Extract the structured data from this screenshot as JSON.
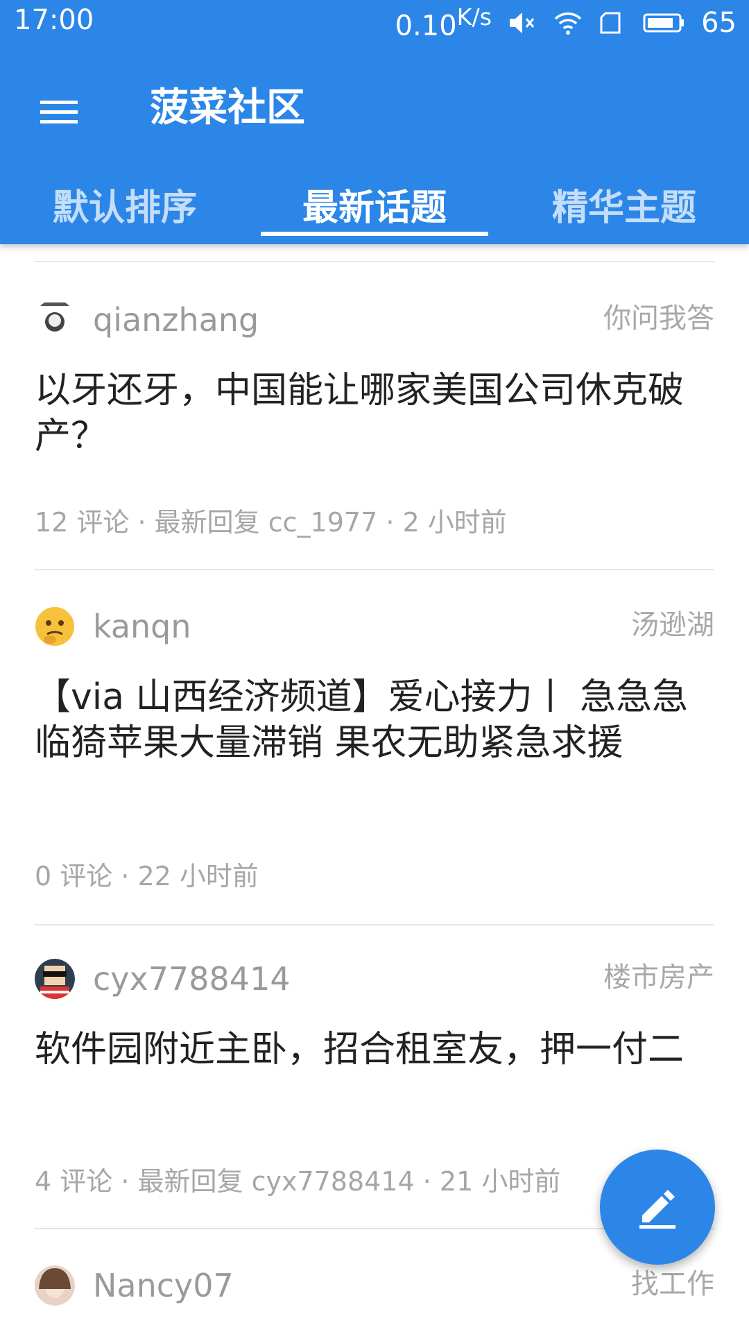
{
  "status_bar": {
    "time": "17:00",
    "net_speed": "0.10",
    "net_unit": "K/s",
    "battery": "65"
  },
  "toolbar": {
    "title": "菠菜社区",
    "menu_icon": "hamburger-menu-icon"
  },
  "tabs": [
    {
      "label": "默认排序",
      "active": false
    },
    {
      "label": "最新话题",
      "active": true
    },
    {
      "label": "精华主题",
      "active": false
    }
  ],
  "posts": [
    {
      "username": "qianzhang",
      "category": "你问我答",
      "title": "以牙还牙，中国能让哪家美国公司休克破产？",
      "meta": "12 评论 · 最新回复 cc_1977 · 2 小时前"
    },
    {
      "username": "kanqn",
      "category": "汤逊湖",
      "title": "【via 山西经济频道】爱心接力丨 急急急 临猗苹果大量滞销 果农无助紧急求援",
      "meta": "0 评论 · 22 小时前"
    },
    {
      "username": "cyx7788414",
      "category": "楼市房产",
      "title": "软件园附近主卧，招合租室友，押一付二",
      "meta": "4 评论 · 最新回复 cyx7788414 · 21 小时前"
    },
    {
      "username": "Nancy07",
      "category": "找工作",
      "title": "",
      "meta": ""
    }
  ],
  "fab": {
    "icon": "edit-pencil-icon"
  },
  "colors": {
    "primary": "#2b86e8"
  }
}
